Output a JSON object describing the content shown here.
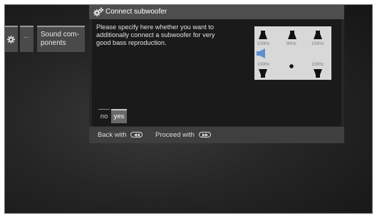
{
  "menu_path": {
    "settings_icon": "gear-icon",
    "ellipsis": "...",
    "current": "Sound com-ponents"
  },
  "dialog": {
    "icon": "gears-icon",
    "title": "Connect subwoofer",
    "message": "Please specify here whether you want to additionally connect a subwoofer for very good bass reproduction.",
    "diagram": {
      "front_left_freq": "100Hz",
      "center_freq": "90Hz",
      "front_right_freq": "100Hz",
      "rear_left_freq": "100Hz",
      "rear_right_freq": "100Hz",
      "highlighted": "subwoofer",
      "highlight_color": "#5b8fd0"
    },
    "options": {
      "no": "no",
      "yes": "yes",
      "selected": "yes"
    },
    "footer": {
      "back_label": "Back with",
      "back_key_icon": "rewind-key-icon",
      "proceed_label": "Proceed with",
      "proceed_key_icon": "fast-forward-key-icon"
    }
  }
}
